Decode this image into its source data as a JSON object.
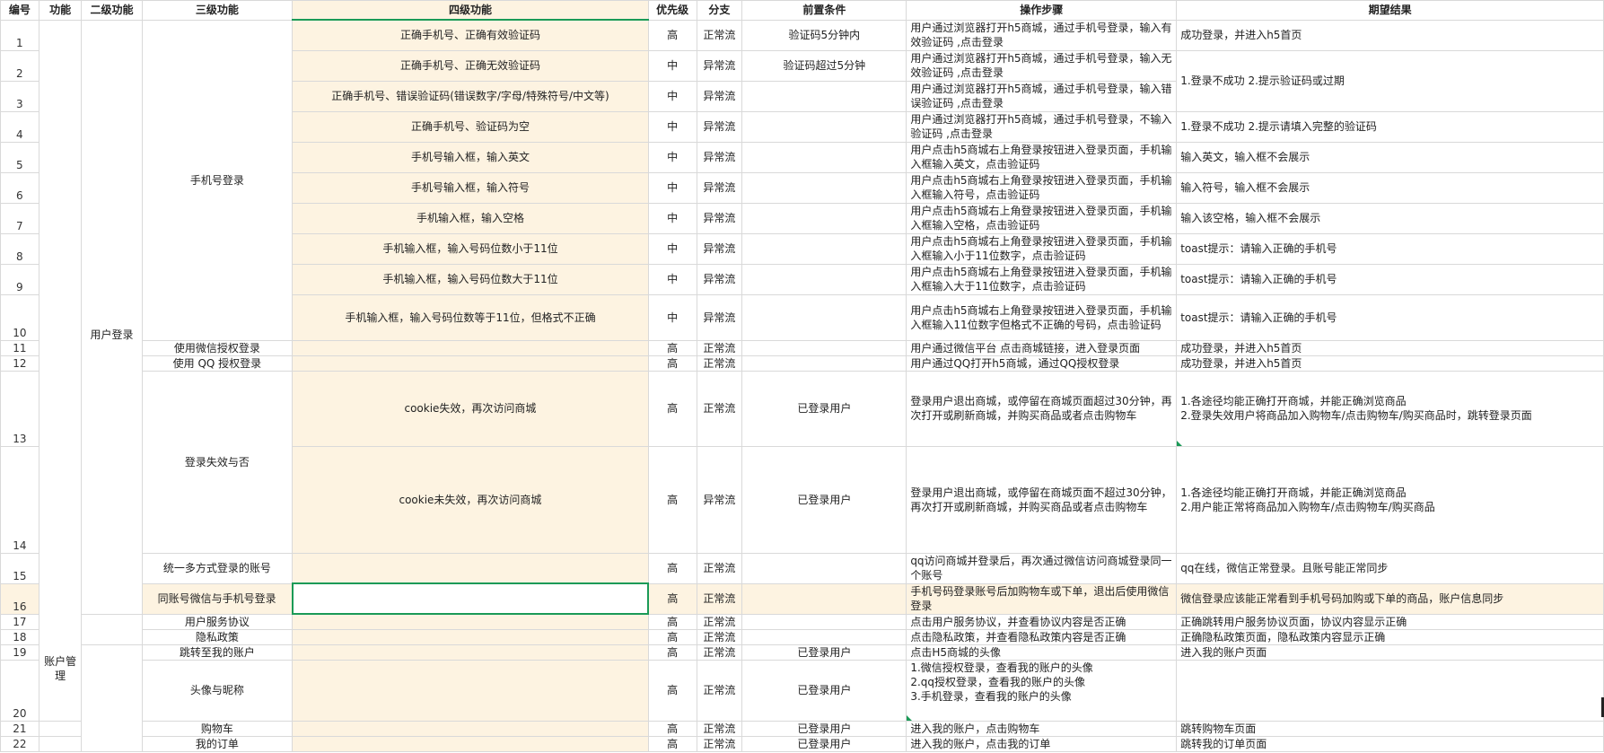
{
  "headers": [
    "编号",
    "功能",
    "二级功能",
    "三级功能",
    "四级功能",
    "优先级",
    "分支",
    "前置条件",
    "操作步骤",
    "期望结果"
  ],
  "col1_merge": "账户管理",
  "col2_merge": "用户登录",
  "col3_merges": {
    "phone_login": "手机号登录",
    "login_expiry": "登录失效与否"
  },
  "rows": [
    {
      "n": "1",
      "l4": "正确手机号、正确有效验证码",
      "p": "高",
      "b": "正常流",
      "pre": "验证码5分钟内",
      "steps": "用户通过浏览器打开h5商城，通过手机号登录，输入有效验证码 ,点击登录",
      "exp": "成功登录，并进入h5首页"
    },
    {
      "n": "2",
      "l4": "正确手机号、正确无效验证码",
      "p": "中",
      "b": "异常流",
      "pre": "验证码超过5分钟",
      "steps": "用户通过浏览器打开h5商城，通过手机号登录，输入无效验证码 ,点击登录",
      "exp": "1.登录不成功 2.提示验证码或过期"
    },
    {
      "n": "3",
      "l4": "正确手机号、错误验证码(错误数字/字母/特殊符号/中文等)",
      "p": "中",
      "b": "异常流",
      "pre": "",
      "steps": "用户通过浏览器打开h5商城，通过手机号登录，输入错误验证码 ,点击登录",
      "exp": ""
    },
    {
      "n": "4",
      "l4": "正确手机号、验证码为空",
      "p": "中",
      "b": "异常流",
      "pre": "",
      "steps": "用户通过浏览器打开h5商城，通过手机号登录，不输入验证码 ,点击登录",
      "exp": "1.登录不成功 2.提示请填入完整的验证码"
    },
    {
      "n": "5",
      "l4": "手机号输入框，输入英文",
      "p": "中",
      "b": "异常流",
      "pre": "",
      "steps": "用户点击h5商城右上角登录按钮进入登录页面，手机输入框输入英文，点击验证码",
      "exp": "输入英文，输入框不会展示"
    },
    {
      "n": "6",
      "l4": "手机号输入框，输入符号",
      "p": "中",
      "b": "异常流",
      "pre": "",
      "steps": "用户点击h5商城右上角登录按钮进入登录页面，手机输入框输入符号，点击验证码",
      "exp": "输入符号，输入框不会展示"
    },
    {
      "n": "7",
      "l4": "手机输入框，输入空格",
      "p": "中",
      "b": "异常流",
      "pre": "",
      "steps": "用户点击h5商城右上角登录按钮进入登录页面，手机输入框输入空格，点击验证码",
      "exp": "输入该空格，输入框不会展示"
    },
    {
      "n": "8",
      "l4": "手机输入框，输入号码位数小于11位",
      "p": "中",
      "b": "异常流",
      "pre": "",
      "steps": "用户点击h5商城右上角登录按钮进入登录页面，手机输入框输入小于11位数字，点击验证码",
      "exp": "toast提示：请输入正确的手机号"
    },
    {
      "n": "9",
      "l4": "手机输入框，输入号码位数大于11位",
      "p": "中",
      "b": "异常流",
      "pre": "",
      "steps": "用户点击h5商城右上角登录按钮进入登录页面，手机输入框输入大于11位数字，点击验证码",
      "exp": "toast提示：请输入正确的手机号"
    },
    {
      "n": "10",
      "l4": "手机输入框，输入号码位数等于11位，但格式不正确",
      "p": "中",
      "b": "异常流",
      "pre": "",
      "steps": "用户点击h5商城右上角登录按钮进入登录页面，手机输入框输入11位数字但格式不正确的号码，点击验证码",
      "exp": "toast提示：请输入正确的手机号"
    },
    {
      "n": "11",
      "l3": "使用微信授权登录",
      "l4": "",
      "p": "高",
      "b": "正常流",
      "pre": "",
      "steps": "用户通过微信平台 点击商城链接，进入登录页面",
      "exp": "成功登录，并进入h5首页"
    },
    {
      "n": "12",
      "l3": "使用 QQ 授权登录",
      "l4": "",
      "p": "高",
      "b": "正常流",
      "pre": "",
      "steps": "用户通过QQ打开h5商城，通过QQ授权登录",
      "exp": "成功登录，并进入h5首页"
    },
    {
      "n": "13",
      "l4": "cookie失效，再次访问商城",
      "p": "高",
      "b": "正常流",
      "pre": "已登录用户",
      "steps": "登录用户退出商城，或停留在商城页面超过30分钟，再次打开或刷新商城，并购买商品或者点击购物车",
      "exp": "1.各途径均能正确打开商城，并能正确浏览商品\n2.登录失效用户将商品加入购物车/点击购物车/购买商品时，跳转登录页面"
    },
    {
      "n": "14",
      "l4": "cookie未失效，再次访问商城",
      "p": "高",
      "b": "异常流",
      "pre": "已登录用户",
      "steps": "登录用户退出商城，或停留在商城页面不超过30分钟，再次打开或刷新商城，并购买商品或者点击购物车",
      "exp": "1.各途径均能正确打开商城，并能正确浏览商品\n2.用户能正常将商品加入购物车/点击购物车/购买商品"
    },
    {
      "n": "15",
      "l3": "统一多方式登录的账号",
      "l4": "",
      "p": "高",
      "b": "正常流",
      "pre": "",
      "steps": "qq访问商城并登录后，再次通过微信访问商城登录同一个账号",
      "exp": "qq在线，微信正常登录。且账号能正常同步"
    },
    {
      "n": "16",
      "l3": "同账号微信与手机号登录",
      "l4": "",
      "p": "高",
      "b": "正常流",
      "pre": "",
      "steps": "手机号码登录账号后加购物车或下单，退出后使用微信登录",
      "exp": "微信登录应该能正常看到手机号码加购或下单的商品，账户信息同步"
    },
    {
      "n": "17",
      "l3": "用户服务协议",
      "l4": "",
      "p": "高",
      "b": "正常流",
      "pre": "",
      "steps": "点击用户服务协议，并查看协议内容是否正确",
      "exp": "正确跳转用户服务协议页面，协议内容显示正确"
    },
    {
      "n": "18",
      "l3": "隐私政策",
      "l4": "",
      "p": "高",
      "b": "正常流",
      "pre": "",
      "steps": "点击隐私政策，并查看隐私政策内容是否正确",
      "exp": "正确隐私政策页面，隐私政策内容显示正确"
    },
    {
      "n": "19",
      "l3": "跳转至我的账户",
      "l4": "",
      "p": "高",
      "b": "正常流",
      "pre": "已登录用户",
      "steps": "点击H5商城的头像",
      "exp": "进入我的账户页面"
    },
    {
      "n": "20",
      "l3": "头像与昵称",
      "l4": "",
      "p": "高",
      "b": "正常流",
      "pre": "已登录用户",
      "steps": "1.微信授权登录，查看我的账户的头像\n2.qq授权登录，查看我的账户的头像\n3.手机登录，查看我的账户的头像",
      "exp": ""
    },
    {
      "n": "21",
      "l3": "购物车",
      "l4": "",
      "p": "高",
      "b": "正常流",
      "pre": "已登录用户",
      "steps": "进入我的账户，点击购物车",
      "exp": "跳转购物车页面"
    },
    {
      "n": "22",
      "l3": "我的订单",
      "l4": "",
      "p": "高",
      "b": "正常流",
      "pre": "已登录用户",
      "steps": "进入我的账户，点击我的订单",
      "exp": "跳转我的订单页面"
    }
  ]
}
